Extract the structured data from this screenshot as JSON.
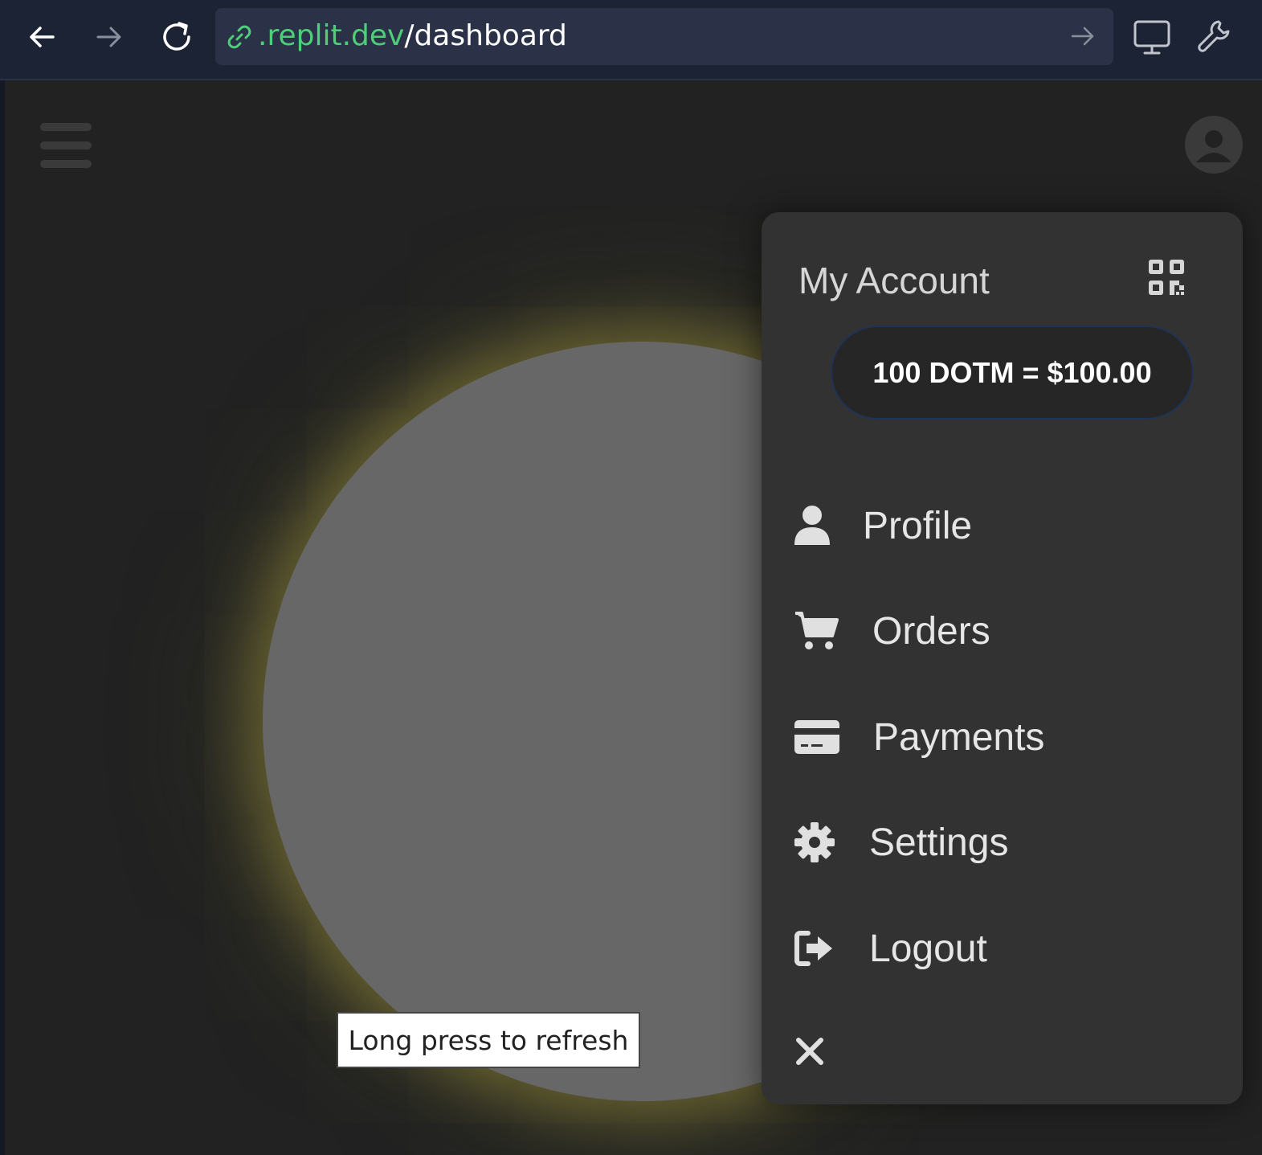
{
  "browser": {
    "url_host": ".replit.dev",
    "url_path": "/dashboard",
    "back_icon": "arrow-left-icon",
    "forward_icon": "arrow-right-icon",
    "reload_icon": "reload-icon",
    "go_icon": "arrow-right-icon",
    "desktop_icon": "monitor-icon",
    "devtools_icon": "wrench-icon"
  },
  "app": {
    "tooltip": "Long press to refresh"
  },
  "account_menu": {
    "title": "My Account",
    "balance": "100 DOTM = $100.00",
    "items": [
      {
        "label": "Profile",
        "icon": "user-icon"
      },
      {
        "label": "Orders",
        "icon": "cart-icon"
      },
      {
        "label": "Payments",
        "icon": "credit-card-icon"
      },
      {
        "label": "Settings",
        "icon": "gear-icon"
      },
      {
        "label": "Logout",
        "icon": "logout-icon"
      }
    ]
  },
  "colors": {
    "browser_bar": "#1c2334",
    "url_host": "#4ccf77",
    "app_bg": "#222222",
    "menu_bg": "#323232",
    "orb": "#676767",
    "glow": "#968c3c"
  }
}
